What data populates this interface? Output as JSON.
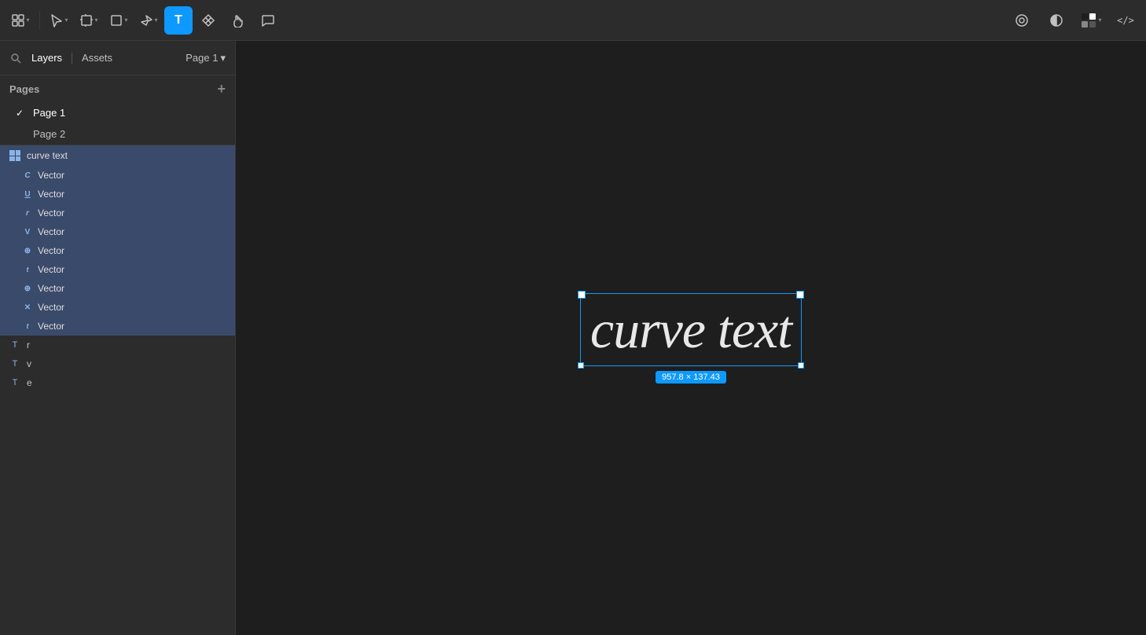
{
  "toolbar": {
    "tools": [
      {
        "name": "apps-icon",
        "label": "▦",
        "active": false,
        "has_chevron": true
      },
      {
        "name": "select-tool",
        "label": "↖",
        "active": false,
        "has_chevron": true
      },
      {
        "name": "frame-tool",
        "label": "⊞",
        "active": false,
        "has_chevron": true
      },
      {
        "name": "shape-tool",
        "label": "□",
        "active": false,
        "has_chevron": true
      },
      {
        "name": "pen-tool",
        "label": "✏",
        "active": false,
        "has_chevron": true
      },
      {
        "name": "text-tool",
        "label": "T",
        "active": true,
        "has_chevron": false
      },
      {
        "name": "component-tool",
        "label": "⊕",
        "active": false,
        "has_chevron": false
      },
      {
        "name": "hand-tool",
        "label": "✋",
        "active": false,
        "has_chevron": false
      },
      {
        "name": "comment-tool",
        "label": "💬",
        "active": false,
        "has_chevron": false
      }
    ],
    "right_tools": [
      {
        "name": "figma-community",
        "label": "◈"
      },
      {
        "name": "contrast-tool",
        "label": "◑"
      },
      {
        "name": "color-picker",
        "label": "■",
        "has_chevron": true
      },
      {
        "name": "code-view",
        "label": "</>"
      }
    ]
  },
  "left_panel": {
    "tabs": [
      {
        "name": "layers-tab",
        "label": "Layers",
        "active": true
      },
      {
        "name": "assets-tab",
        "label": "Assets",
        "active": false
      }
    ],
    "page_selector": {
      "label": "Page 1",
      "chevron": "▾"
    },
    "pages_section": {
      "header": "Pages",
      "add_button": "+",
      "pages": [
        {
          "name": "page-1-item",
          "label": "Page 1",
          "active": true
        },
        {
          "name": "page-2-item",
          "label": "Page 2",
          "active": false
        }
      ]
    },
    "layers": {
      "group": {
        "name": "curve-text-group",
        "label": "curve text",
        "icon": "grid"
      },
      "vectors": [
        {
          "name": "vector-c",
          "icon": "C",
          "label": "Vector"
        },
        {
          "name": "vector-u",
          "icon": "U",
          "label": "Vector"
        },
        {
          "name": "vector-r",
          "icon": "r",
          "label": "Vector"
        },
        {
          "name": "vector-v",
          "icon": "V",
          "label": "Vector"
        },
        {
          "name": "vector-e-circle",
          "icon": "⊕",
          "label": "Vector"
        },
        {
          "name": "vector-t",
          "icon": "t",
          "label": "Vector"
        },
        {
          "name": "vector-e2",
          "icon": "⊕",
          "label": "Vector"
        },
        {
          "name": "vector-x",
          "icon": "✕",
          "label": "Vector"
        },
        {
          "name": "vector-t2",
          "icon": "t",
          "label": "Vector"
        }
      ],
      "text_layers": [
        {
          "name": "text-r",
          "label": "r"
        },
        {
          "name": "text-v",
          "label": "v"
        },
        {
          "name": "text-e",
          "label": "e"
        }
      ]
    }
  },
  "canvas": {
    "curve_text": "curve text",
    "size_label": "957.8 × 137.43"
  }
}
